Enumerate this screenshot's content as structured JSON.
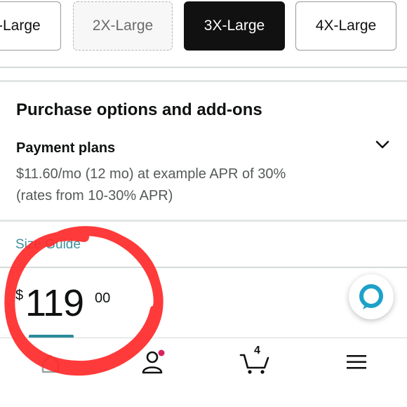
{
  "sizes": [
    {
      "label": "-Large",
      "state": "available"
    },
    {
      "label": "2X-Large",
      "state": "unavailable"
    },
    {
      "label": "3X-Large",
      "state": "selected"
    },
    {
      "label": "4X-Large",
      "state": "available"
    }
  ],
  "purchase_options": {
    "title": "Purchase options and add-ons",
    "payment_plans": {
      "title": "Payment plans",
      "description": "$11.60/mo (12 mo) at example APR of 30% (rates from 10-30% APR)"
    }
  },
  "size_guide": {
    "label": "Size Guide"
  },
  "price": {
    "symbol": "$",
    "whole": "119",
    "fraction": "00"
  },
  "bottom_nav": {
    "items": [
      "home",
      "account",
      "cart",
      "menu"
    ],
    "cart_count": "4"
  },
  "icons": {
    "chevron": "chevron-down-icon",
    "alexa": "alexa-icon",
    "home": "home-icon",
    "account": "user-icon",
    "cart": "cart-icon",
    "menu": "hamburger-menu-icon"
  },
  "colors": {
    "selected_chip": "#111111",
    "link": "#3f8f9c",
    "alexa_ring": "#1da1c9",
    "notification_dot": "#d5245f",
    "annotation_ink": "#ff2a2a"
  }
}
